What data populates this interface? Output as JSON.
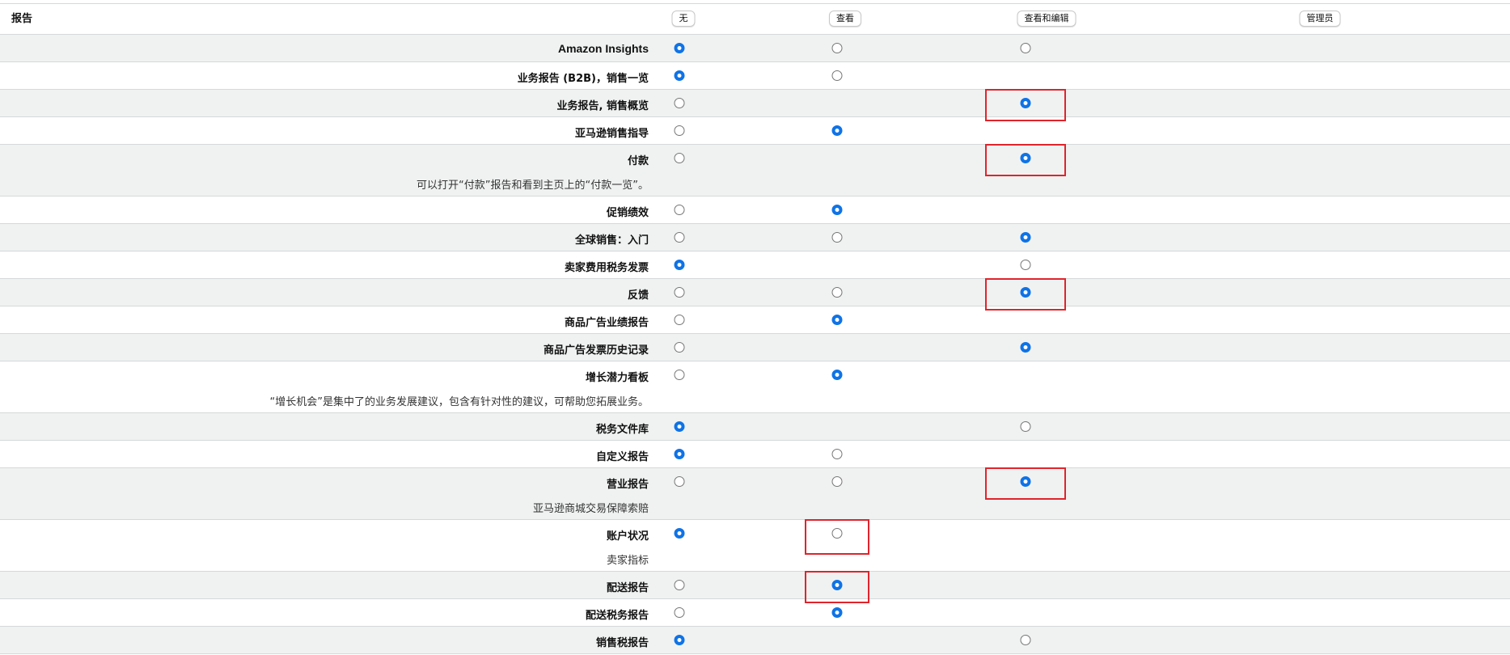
{
  "header": {
    "title": "报告",
    "columns": [
      "无",
      "查看",
      "查看和编辑",
      "管理员"
    ]
  },
  "rows": [
    {
      "label": "Amazon Insights",
      "description": "",
      "options": [
        "on",
        "off",
        "off",
        null
      ]
    },
    {
      "label": "业务报告 (B2B)，销售一览",
      "description": "",
      "options": [
        "on",
        "off",
        null,
        null
      ]
    },
    {
      "label": "业务报告, 销售概览",
      "description": "",
      "options": [
        "off",
        null,
        "on",
        null
      ]
    },
    {
      "label": "亚马逊销售指导",
      "description": "",
      "options": [
        "off",
        "on",
        null,
        null
      ]
    },
    {
      "label": "付款",
      "description": "可以打开“付款”报告和看到主页上的“付款一览”。",
      "options": [
        "off",
        null,
        "on",
        null
      ]
    },
    {
      "label": "促销绩效",
      "description": "",
      "options": [
        "off",
        "on",
        null,
        null
      ]
    },
    {
      "label": "全球销售：入门",
      "description": "",
      "options": [
        "off",
        "off",
        "on",
        null
      ]
    },
    {
      "label": "卖家费用税务发票",
      "description": "",
      "options": [
        "on",
        null,
        "off",
        null
      ]
    },
    {
      "label": "反馈",
      "description": "",
      "options": [
        "off",
        "off",
        "on",
        null
      ]
    },
    {
      "label": "商品广告业绩报告",
      "description": "",
      "options": [
        "off",
        "on",
        null,
        null
      ]
    },
    {
      "label": "商品广告发票历史记录",
      "description": "",
      "options": [
        "off",
        null,
        "on",
        null
      ]
    },
    {
      "label": "增长潜力看板",
      "description": "“增长机会”是集中了的业务发展建议，包含有针对性的建议，可帮助您拓展业务。",
      "options": [
        "off",
        "on",
        null,
        null
      ]
    },
    {
      "label": "税务文件库",
      "description": "",
      "options": [
        "on",
        null,
        "off",
        null
      ]
    },
    {
      "label": "自定义报告",
      "description": "",
      "options": [
        "on",
        "off",
        null,
        null
      ]
    },
    {
      "label": "营业报告",
      "description": "亚马逊商城交易保障索赔",
      "options": [
        "off",
        "off",
        "on",
        null
      ]
    },
    {
      "label": "账户状况",
      "description": "卖家指标",
      "options": [
        "on",
        "off",
        null,
        null
      ]
    },
    {
      "label": "配送报告",
      "description": "",
      "options": [
        "off",
        "on",
        null,
        null
      ]
    },
    {
      "label": "配送税务报告",
      "description": "",
      "options": [
        "off",
        "on",
        null,
        null
      ]
    },
    {
      "label": "销售税报告",
      "description": "",
      "options": [
        "on",
        null,
        "off",
        null
      ]
    }
  ],
  "highlights": [
    {
      "row": 2,
      "col": 2
    },
    {
      "row": 4,
      "col": 2
    },
    {
      "row": 8,
      "col": 2
    },
    {
      "row": 14,
      "col": 2
    },
    {
      "row": 15,
      "col": 1
    },
    {
      "row": 16,
      "col": 1
    }
  ],
  "colors": {
    "radio_selected": "#0f73e6",
    "highlight_border": "#e0242c",
    "row_shade": "#f0f2f2"
  }
}
